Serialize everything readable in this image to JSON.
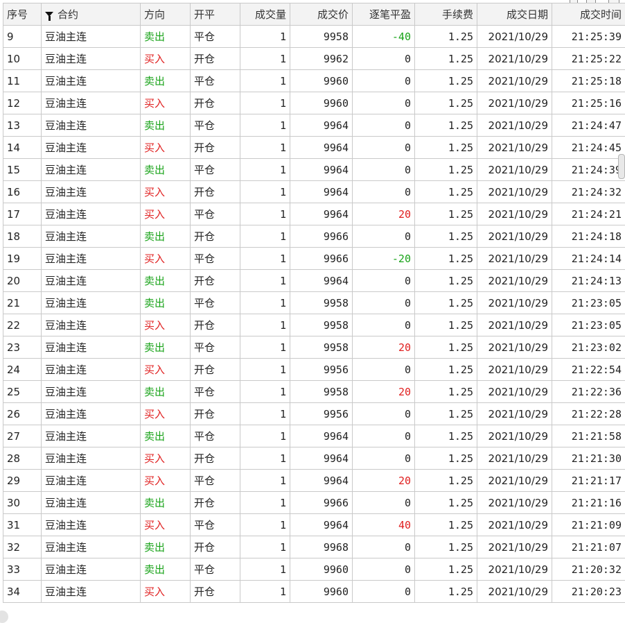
{
  "table": {
    "headers": {
      "seq": "序号",
      "contract": "合约",
      "direction": "方向",
      "open_close": "开平",
      "qty": "成交量",
      "price": "成交价",
      "pnl": "逐笔平盈",
      "fee": "手续费",
      "date": "成交日期",
      "time": "成交时间"
    },
    "rows": [
      {
        "seq": "9",
        "contract": "豆油主连",
        "direction": "卖出",
        "open_close": "平仓",
        "qty": "1",
        "price": "9958",
        "pnl": "-40",
        "fee": "1.25",
        "date": "2021/10/29",
        "time": "21:25:39"
      },
      {
        "seq": "10",
        "contract": "豆油主连",
        "direction": "买入",
        "open_close": "开仓",
        "qty": "1",
        "price": "9962",
        "pnl": "0",
        "fee": "1.25",
        "date": "2021/10/29",
        "time": "21:25:22"
      },
      {
        "seq": "11",
        "contract": "豆油主连",
        "direction": "卖出",
        "open_close": "平仓",
        "qty": "1",
        "price": "9960",
        "pnl": "0",
        "fee": "1.25",
        "date": "2021/10/29",
        "time": "21:25:18"
      },
      {
        "seq": "12",
        "contract": "豆油主连",
        "direction": "买入",
        "open_close": "开仓",
        "qty": "1",
        "price": "9960",
        "pnl": "0",
        "fee": "1.25",
        "date": "2021/10/29",
        "time": "21:25:16"
      },
      {
        "seq": "13",
        "contract": "豆油主连",
        "direction": "卖出",
        "open_close": "平仓",
        "qty": "1",
        "price": "9964",
        "pnl": "0",
        "fee": "1.25",
        "date": "2021/10/29",
        "time": "21:24:47"
      },
      {
        "seq": "14",
        "contract": "豆油主连",
        "direction": "买入",
        "open_close": "开仓",
        "qty": "1",
        "price": "9964",
        "pnl": "0",
        "fee": "1.25",
        "date": "2021/10/29",
        "time": "21:24:45"
      },
      {
        "seq": "15",
        "contract": "豆油主连",
        "direction": "卖出",
        "open_close": "平仓",
        "qty": "1",
        "price": "9964",
        "pnl": "0",
        "fee": "1.25",
        "date": "2021/10/29",
        "time": "21:24:39"
      },
      {
        "seq": "16",
        "contract": "豆油主连",
        "direction": "买入",
        "open_close": "开仓",
        "qty": "1",
        "price": "9964",
        "pnl": "0",
        "fee": "1.25",
        "date": "2021/10/29",
        "time": "21:24:32"
      },
      {
        "seq": "17",
        "contract": "豆油主连",
        "direction": "买入",
        "open_close": "平仓",
        "qty": "1",
        "price": "9964",
        "pnl": "20",
        "fee": "1.25",
        "date": "2021/10/29",
        "time": "21:24:21"
      },
      {
        "seq": "18",
        "contract": "豆油主连",
        "direction": "卖出",
        "open_close": "开仓",
        "qty": "1",
        "price": "9966",
        "pnl": "0",
        "fee": "1.25",
        "date": "2021/10/29",
        "time": "21:24:18"
      },
      {
        "seq": "19",
        "contract": "豆油主连",
        "direction": "买入",
        "open_close": "平仓",
        "qty": "1",
        "price": "9966",
        "pnl": "-20",
        "fee": "1.25",
        "date": "2021/10/29",
        "time": "21:24:14"
      },
      {
        "seq": "20",
        "contract": "豆油主连",
        "direction": "卖出",
        "open_close": "开仓",
        "qty": "1",
        "price": "9964",
        "pnl": "0",
        "fee": "1.25",
        "date": "2021/10/29",
        "time": "21:24:13"
      },
      {
        "seq": "21",
        "contract": "豆油主连",
        "direction": "卖出",
        "open_close": "平仓",
        "qty": "1",
        "price": "9958",
        "pnl": "0",
        "fee": "1.25",
        "date": "2021/10/29",
        "time": "21:23:05"
      },
      {
        "seq": "22",
        "contract": "豆油主连",
        "direction": "买入",
        "open_close": "开仓",
        "qty": "1",
        "price": "9958",
        "pnl": "0",
        "fee": "1.25",
        "date": "2021/10/29",
        "time": "21:23:05"
      },
      {
        "seq": "23",
        "contract": "豆油主连",
        "direction": "卖出",
        "open_close": "平仓",
        "qty": "1",
        "price": "9958",
        "pnl": "20",
        "fee": "1.25",
        "date": "2021/10/29",
        "time": "21:23:02"
      },
      {
        "seq": "24",
        "contract": "豆油主连",
        "direction": "买入",
        "open_close": "开仓",
        "qty": "1",
        "price": "9956",
        "pnl": "0",
        "fee": "1.25",
        "date": "2021/10/29",
        "time": "21:22:54"
      },
      {
        "seq": "25",
        "contract": "豆油主连",
        "direction": "卖出",
        "open_close": "平仓",
        "qty": "1",
        "price": "9958",
        "pnl": "20",
        "fee": "1.25",
        "date": "2021/10/29",
        "time": "21:22:36"
      },
      {
        "seq": "26",
        "contract": "豆油主连",
        "direction": "买入",
        "open_close": "开仓",
        "qty": "1",
        "price": "9956",
        "pnl": "0",
        "fee": "1.25",
        "date": "2021/10/29",
        "time": "21:22:28"
      },
      {
        "seq": "27",
        "contract": "豆油主连",
        "direction": "卖出",
        "open_close": "平仓",
        "qty": "1",
        "price": "9964",
        "pnl": "0",
        "fee": "1.25",
        "date": "2021/10/29",
        "time": "21:21:58"
      },
      {
        "seq": "28",
        "contract": "豆油主连",
        "direction": "买入",
        "open_close": "开仓",
        "qty": "1",
        "price": "9964",
        "pnl": "0",
        "fee": "1.25",
        "date": "2021/10/29",
        "time": "21:21:30"
      },
      {
        "seq": "29",
        "contract": "豆油主连",
        "direction": "买入",
        "open_close": "平仓",
        "qty": "1",
        "price": "9964",
        "pnl": "20",
        "fee": "1.25",
        "date": "2021/10/29",
        "time": "21:21:17"
      },
      {
        "seq": "30",
        "contract": "豆油主连",
        "direction": "卖出",
        "open_close": "开仓",
        "qty": "1",
        "price": "9966",
        "pnl": "0",
        "fee": "1.25",
        "date": "2021/10/29",
        "time": "21:21:16"
      },
      {
        "seq": "31",
        "contract": "豆油主连",
        "direction": "买入",
        "open_close": "平仓",
        "qty": "1",
        "price": "9964",
        "pnl": "40",
        "fee": "1.25",
        "date": "2021/10/29",
        "time": "21:21:09"
      },
      {
        "seq": "32",
        "contract": "豆油主连",
        "direction": "卖出",
        "open_close": "开仓",
        "qty": "1",
        "price": "9968",
        "pnl": "0",
        "fee": "1.25",
        "date": "2021/10/29",
        "time": "21:21:07"
      },
      {
        "seq": "33",
        "contract": "豆油主连",
        "direction": "卖出",
        "open_close": "平仓",
        "qty": "1",
        "price": "9960",
        "pnl": "0",
        "fee": "1.25",
        "date": "2021/10/29",
        "time": "21:20:32"
      },
      {
        "seq": "34",
        "contract": "豆油主连",
        "direction": "买入",
        "open_close": "开仓",
        "qty": "1",
        "price": "9960",
        "pnl": "0",
        "fee": "1.25",
        "date": "2021/10/29",
        "time": "21:20:23"
      }
    ]
  },
  "colors": {
    "buy": "#e02020",
    "sell": "#19a319",
    "header_bg": "#f3f3f3",
    "grid": "#c9c9c9"
  },
  "icons": {
    "filter": "filter-icon"
  }
}
